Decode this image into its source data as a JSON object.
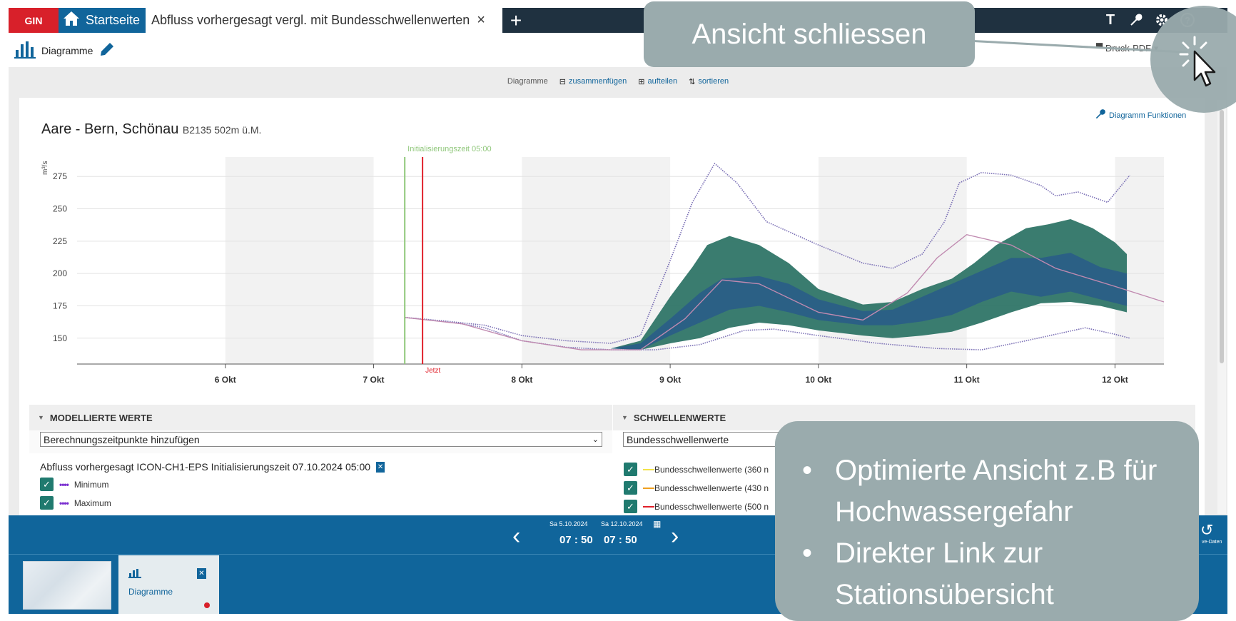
{
  "topbar": {
    "brand": "GIN",
    "home_label": "Startseite",
    "active_tab": "Abfluss vorhergesagt vergl. mit Bundesschwellenwerten",
    "close_glyph": "×",
    "add_glyph": "+",
    "text_icon": "T"
  },
  "secondary": {
    "view_label": "Diagramme",
    "print_label": "Druck-PDF"
  },
  "toolstrip": {
    "label": "Diagramme",
    "merge": "zusammenfügen",
    "split": "aufteilen",
    "sort": "sortieren"
  },
  "chart_header": {
    "station": "Aare - Bern, Schönau",
    "station_meta": "B2135 502m  ü.M.",
    "functions": "Diagramm Funktionen"
  },
  "chart_data": {
    "type": "area",
    "ylabel": "m³/s",
    "yticks": [
      150,
      175,
      200,
      225,
      250,
      275
    ],
    "ylim": [
      130,
      290
    ],
    "xlim": [
      5.0,
      12.33
    ],
    "xticks": [
      {
        "x": 6,
        "label": "6 Okt"
      },
      {
        "x": 7,
        "label": "7 Okt"
      },
      {
        "x": 8,
        "label": "8 Okt"
      },
      {
        "x": 9,
        "label": "9 Okt"
      },
      {
        "x": 10,
        "label": "10 Okt"
      },
      {
        "x": 11,
        "label": "11 Okt"
      },
      {
        "x": 12,
        "label": "12 Okt"
      }
    ],
    "init_marker": {
      "x": 7.21,
      "label": "Initialisierungszeit 05:00",
      "color": "#8fc77a"
    },
    "now_marker": {
      "x": 7.33,
      "label": "Jetzt",
      "color": "#e0202a"
    },
    "night_bands": [
      [
        6.0,
        7.0
      ],
      [
        8.0,
        9.0
      ],
      [
        10.0,
        11.0
      ],
      [
        12.0,
        12.33
      ]
    ],
    "series": [
      {
        "name": "Maximum",
        "color": "#7a6fb5",
        "dashed": true,
        "points": [
          [
            7.21,
            166
          ],
          [
            7.5,
            163
          ],
          [
            7.75,
            160
          ],
          [
            8.0,
            152
          ],
          [
            8.3,
            148
          ],
          [
            8.6,
            146
          ],
          [
            8.8,
            152
          ],
          [
            9.0,
            210
          ],
          [
            9.15,
            255
          ],
          [
            9.3,
            285
          ],
          [
            9.45,
            270
          ],
          [
            9.65,
            240
          ],
          [
            10.0,
            222
          ],
          [
            10.3,
            208
          ],
          [
            10.5,
            204
          ],
          [
            10.7,
            215
          ],
          [
            10.85,
            240
          ],
          [
            10.95,
            270
          ],
          [
            11.1,
            278
          ],
          [
            11.3,
            276
          ],
          [
            11.5,
            268
          ],
          [
            11.6,
            260
          ],
          [
            11.75,
            263
          ],
          [
            11.95,
            255
          ],
          [
            12.1,
            276
          ]
        ]
      },
      {
        "name": "Minimum",
        "color": "#7a6fb5",
        "dashed": true,
        "points": [
          [
            7.21,
            166
          ],
          [
            7.5,
            163
          ],
          [
            7.75,
            158
          ],
          [
            8.0,
            148
          ],
          [
            8.3,
            143
          ],
          [
            8.6,
            141
          ],
          [
            8.9,
            141
          ],
          [
            9.2,
            145
          ],
          [
            9.5,
            156
          ],
          [
            9.7,
            157
          ],
          [
            10.0,
            152
          ],
          [
            10.4,
            146
          ],
          [
            10.8,
            142
          ],
          [
            11.1,
            141
          ],
          [
            11.4,
            148
          ],
          [
            11.8,
            158
          ],
          [
            12.0,
            153
          ],
          [
            12.1,
            150
          ]
        ]
      },
      {
        "name": "Median",
        "color": "#c08ab0",
        "dashed": false,
        "points": [
          [
            7.21,
            166
          ],
          [
            7.6,
            161
          ],
          [
            8.0,
            148
          ],
          [
            8.4,
            141
          ],
          [
            8.8,
            141
          ],
          [
            9.1,
            165
          ],
          [
            9.35,
            195
          ],
          [
            9.6,
            192
          ],
          [
            10.0,
            170
          ],
          [
            10.3,
            164
          ],
          [
            10.6,
            185
          ],
          [
            10.8,
            212
          ],
          [
            11.0,
            230
          ],
          [
            11.3,
            222
          ],
          [
            11.6,
            204
          ],
          [
            12.0,
            190
          ],
          [
            12.33,
            178
          ]
        ]
      }
    ],
    "outer_band": {
      "color": "#2f7567",
      "upper": [
        [
          8.6,
          142
        ],
        [
          8.8,
          148
        ],
        [
          9.0,
          182
        ],
        [
          9.15,
          205
        ],
        [
          9.25,
          222
        ],
        [
          9.4,
          229
        ],
        [
          9.6,
          222
        ],
        [
          9.8,
          208
        ],
        [
          10.0,
          188
        ],
        [
          10.3,
          176
        ],
        [
          10.5,
          178
        ],
        [
          10.7,
          188
        ],
        [
          10.9,
          196
        ],
        [
          11.05,
          208
        ],
        [
          11.2,
          222
        ],
        [
          11.4,
          235
        ],
        [
          11.55,
          238
        ],
        [
          11.7,
          242
        ],
        [
          11.85,
          235
        ],
        [
          12.0,
          224
        ],
        [
          12.08,
          215
        ]
      ],
      "lower": [
        [
          8.6,
          142
        ],
        [
          8.8,
          141
        ],
        [
          9.0,
          146
        ],
        [
          9.2,
          150
        ],
        [
          9.4,
          158
        ],
        [
          9.6,
          162
        ],
        [
          9.8,
          160
        ],
        [
          10.0,
          156
        ],
        [
          10.3,
          152
        ],
        [
          10.5,
          150
        ],
        [
          10.7,
          152
        ],
        [
          10.9,
          155
        ],
        [
          11.1,
          162
        ],
        [
          11.3,
          170
        ],
        [
          11.5,
          177
        ],
        [
          11.7,
          178
        ],
        [
          11.9,
          175
        ],
        [
          12.08,
          170
        ]
      ]
    },
    "inner_band": {
      "color": "#2a5f86",
      "upper": [
        [
          8.6,
          142
        ],
        [
          8.8,
          146
        ],
        [
          9.0,
          165
        ],
        [
          9.2,
          185
        ],
        [
          9.35,
          196
        ],
        [
          9.6,
          198
        ],
        [
          9.8,
          192
        ],
        [
          10.0,
          180
        ],
        [
          10.3,
          171
        ],
        [
          10.5,
          172
        ],
        [
          10.7,
          182
        ],
        [
          10.9,
          192
        ],
        [
          11.1,
          202
        ],
        [
          11.3,
          212
        ],
        [
          11.5,
          212
        ],
        [
          11.7,
          216
        ],
        [
          11.9,
          205
        ],
        [
          12.08,
          200
        ]
      ],
      "lower": [
        [
          8.6,
          142
        ],
        [
          8.8,
          141
        ],
        [
          9.0,
          152
        ],
        [
          9.2,
          162
        ],
        [
          9.4,
          172
        ],
        [
          9.6,
          175
        ],
        [
          9.8,
          170
        ],
        [
          10.0,
          164
        ],
        [
          10.3,
          160
        ],
        [
          10.5,
          160
        ],
        [
          10.7,
          163
        ],
        [
          10.9,
          168
        ],
        [
          11.1,
          178
        ],
        [
          11.3,
          186
        ],
        [
          11.5,
          182
        ],
        [
          11.7,
          186
        ],
        [
          11.9,
          180
        ],
        [
          12.08,
          175
        ]
      ]
    }
  },
  "modelled": {
    "section": "MODELLIERTE WERTE",
    "select_value": "Berechnungszeitpunkte hinzufügen",
    "run_title": "Abfluss vorhergesagt ICON-CH1-EPS Initialisierungszeit 07.10.2024 05:00",
    "items": [
      {
        "label": "Minimum",
        "color": "#7a2fd0"
      },
      {
        "label": "Maximum",
        "color": "#7a2fd0"
      }
    ]
  },
  "thresholds": {
    "section": "SCHWELLENWERTE",
    "select_value": "Bundesschwellenwerte",
    "items": [
      {
        "label": "Bundesschwellenwerte (360 n",
        "color": "#f2e34a"
      },
      {
        "label": "Bundesschwellenwerte (430 n",
        "color": "#f0a020"
      },
      {
        "label": "Bundesschwellenwerte (500 n",
        "color": "#e0202a"
      }
    ]
  },
  "timebar": {
    "date_from": "Sa 5.10.2024",
    "date_to": "Sa 12.10.2024",
    "time_from": "07 : 50",
    "time_to": "07 : 50",
    "live_label": "ve-Daten"
  },
  "thumbnails": {
    "diagram_label": "Diagramme"
  },
  "callouts": {
    "top": "Ansicht schliessen",
    "bullets": [
      "Optimierte Ansicht z.B für Hochwassergefahr",
      "Direkter Link zur Stationsübersicht"
    ]
  }
}
